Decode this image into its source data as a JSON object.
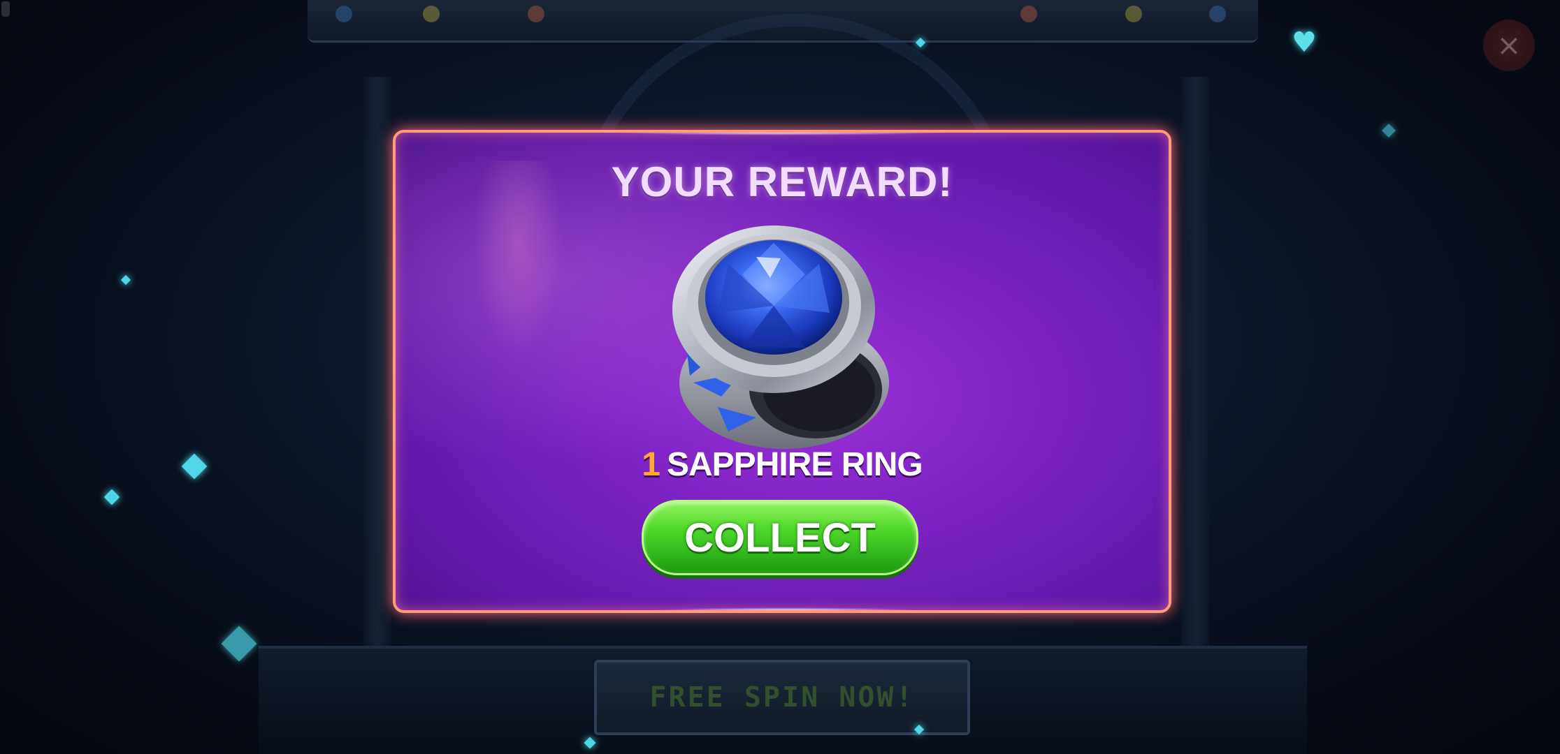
{
  "dialog": {
    "title": "YOUR REWARD!",
    "reward": {
      "quantity": "1",
      "name": "SAPPHIRE RING",
      "icon": "sapphire-ring-icon"
    },
    "collect_label": "COLLECT"
  },
  "background": {
    "plaque_text": "FREE SPIN NOW!",
    "close_icon": "close-icon"
  },
  "colors": {
    "dialog_border": "#ff9b7a",
    "dialog_fill": "#7a22c2",
    "button_green": "#4ed62a",
    "quantity_orange": "#ffa733",
    "sparkle_cyan": "#4fd7e8"
  }
}
